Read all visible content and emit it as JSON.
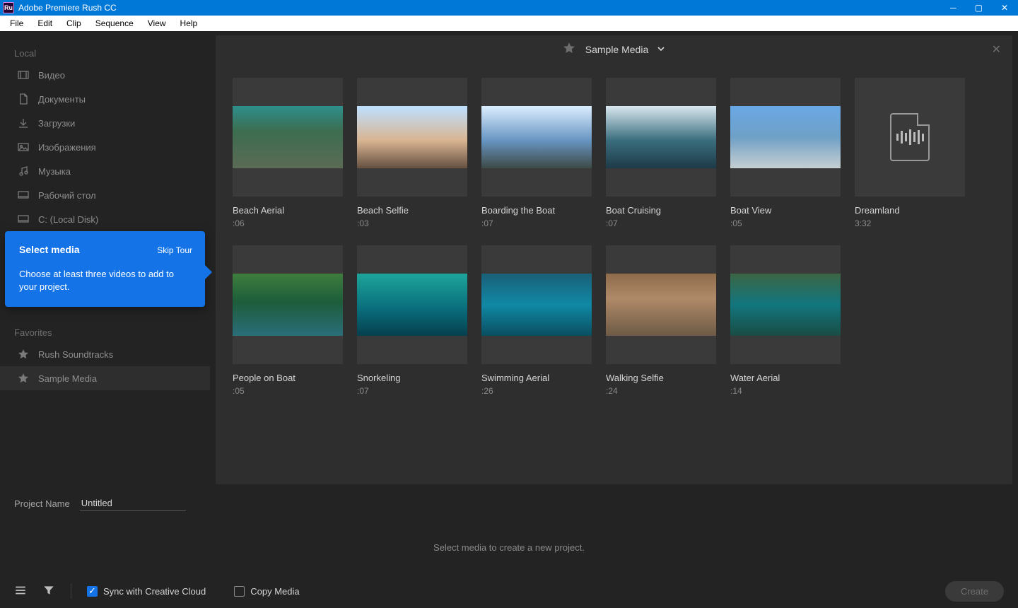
{
  "titlebar": {
    "app_name": "Adobe Premiere Rush CC",
    "icon_label": "Ru"
  },
  "menubar": [
    "File",
    "Edit",
    "Clip",
    "Sequence",
    "View",
    "Help"
  ],
  "sidebar": {
    "local_label": "Local",
    "items": [
      {
        "label": "Видео",
        "icon": "film"
      },
      {
        "label": "Документы",
        "icon": "doc"
      },
      {
        "label": "Загрузки",
        "icon": "download"
      },
      {
        "label": "Изображения",
        "icon": "image"
      },
      {
        "label": "Музыка",
        "icon": "music"
      },
      {
        "label": "Рабочий стол",
        "icon": "desktop"
      },
      {
        "label": "C: (Local Disk)",
        "icon": "disk"
      }
    ],
    "favorites_label": "Favorites",
    "favorites": [
      {
        "label": "Rush Soundtracks",
        "icon": "star"
      },
      {
        "label": "Sample Media",
        "icon": "star",
        "active": true
      }
    ]
  },
  "tour": {
    "title": "Select media",
    "skip": "Skip Tour",
    "body": "Choose at least three videos to add to your project."
  },
  "content": {
    "header_title": "Sample Media",
    "media": [
      {
        "title": "Beach Aerial",
        "duration": ":06",
        "vis": "v-beach-aerial"
      },
      {
        "title": "Beach Selfie",
        "duration": ":03",
        "vis": "v-beach-selfie"
      },
      {
        "title": "Boarding the Boat",
        "duration": ":07",
        "vis": "v-boarding"
      },
      {
        "title": "Boat Cruising",
        "duration": ":07",
        "vis": "v-cruising"
      },
      {
        "title": "Boat View",
        "duration": ":05",
        "vis": "v-boat-view"
      },
      {
        "title": "Dreamland",
        "duration": "3:32",
        "audio": true
      },
      {
        "title": "People on Boat",
        "duration": ":05",
        "vis": "v-people-boat"
      },
      {
        "title": "Snorkeling",
        "duration": ":07",
        "vis": "v-snorkeling"
      },
      {
        "title": "Swimming Aerial",
        "duration": ":26",
        "vis": "v-swimming"
      },
      {
        "title": "Walking Selfie",
        "duration": ":24",
        "vis": "v-walking"
      },
      {
        "title": "Water Aerial",
        "duration": ":14",
        "vis": "v-water-aerial"
      }
    ]
  },
  "bottom": {
    "project_label": "Project Name",
    "project_value": "Untitled",
    "hint": "Select media to create a new project.",
    "sync_label": "Sync with Creative Cloud",
    "copy_label": "Copy Media",
    "create_label": "Create"
  }
}
